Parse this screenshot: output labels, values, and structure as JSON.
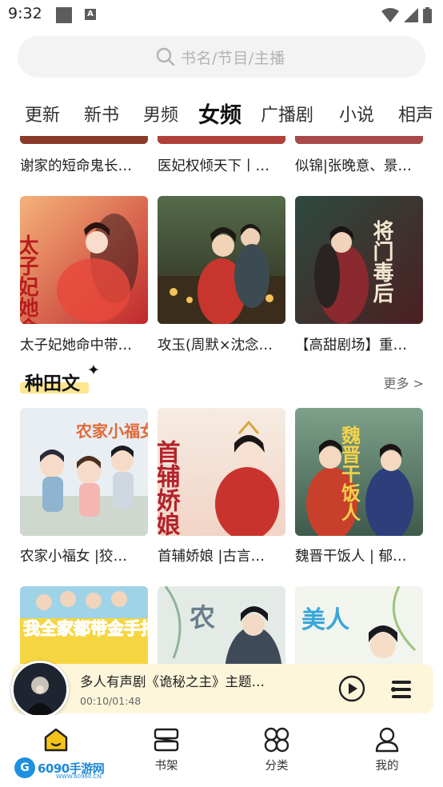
{
  "status_bar": {
    "time": "9:32"
  },
  "search": {
    "placeholder": "书名/节目/主播"
  },
  "tabs": [
    {
      "label": "更新"
    },
    {
      "label": "新书"
    },
    {
      "label": "男频"
    },
    {
      "label": "女频",
      "active": true
    },
    {
      "label": "广播剧"
    },
    {
      "label": "小说"
    },
    {
      "label": "相声"
    }
  ],
  "top_row_titles": [
    "谢家的短命鬼长…",
    "医妃权倾天下丨…",
    "似锦|张晚意、景…"
  ],
  "row_two": [
    {
      "title": "太子妃她命中带…",
      "cover_text": "太子妃她命中带煞"
    },
    {
      "title": "攻玉(周默×沈念…",
      "cover_text": ""
    },
    {
      "title": "【高甜剧场】重…",
      "cover_text": "将门毒后"
    }
  ],
  "section": {
    "title": "种田文",
    "more": "更多 >"
  },
  "section_books": [
    {
      "title": "农家小福女 |狡…",
      "cover_text": "农家小福女"
    },
    {
      "title": "首辅娇娘 |古言…",
      "cover_text": "首辅娇娘"
    },
    {
      "title": "魏晋干饭人 | 郁…",
      "cover_text": "魏晋干饭人"
    }
  ],
  "bottom_row_covers": [
    {
      "cover_text": "我全家都带金手指"
    },
    {
      "cover_text": "农"
    },
    {
      "cover_text": "美人"
    }
  ],
  "player": {
    "title": "多人有声剧《诡秘之主》主题…",
    "time": "00:10/01:48"
  },
  "bottom_nav": [
    {
      "label": "",
      "icon": "home-icon",
      "active": true
    },
    {
      "label": "书架",
      "icon": "bookshelf-icon"
    },
    {
      "label": "分类",
      "icon": "category-icon"
    },
    {
      "label": "我的",
      "icon": "profile-icon"
    }
  ],
  "watermark": {
    "text": "6090手游网",
    "url": "WWW.60960.CN"
  },
  "colors": {
    "accent_yellow": "#f7c21a",
    "highlight": "#fde690",
    "player_bg": "#fdf6db"
  }
}
